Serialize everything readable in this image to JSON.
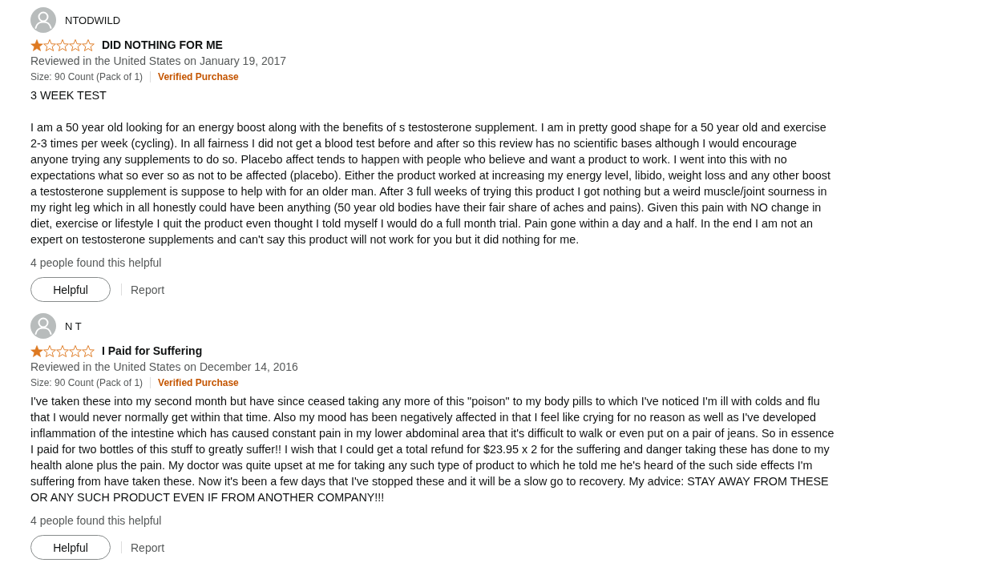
{
  "reviews": [
    {
      "author": "NTODWILD",
      "stars": 1,
      "title": "DID NOTHING FOR ME",
      "date": "Reviewed in the United States on January 19, 2017",
      "size": "Size: 90 Count (Pack of 1)",
      "verified": "Verified Purchase",
      "paragraphs": [
        "3 WEEK TEST",
        "I am a 50 year old looking for an energy boost along with the benefits of s testosterone supplement. I am in pretty good shape for a 50 year old and exercise 2-3 times per week (cycling). In all fairness I did not get a blood test before and after so this review has no scientific bases although I would encourage anyone trying any supplements to do so. Placebo affect tends to happen with people who believe and want a product to work. I went into this with no expectations what so ever so as not to be affected (placebo). Either the product worked at increasing my energy level, libido, weight loss and any other boost a testosterone supplement is suppose to help with for an older man. After 3 full weeks of trying this product I got nothing but a weird muscle/joint sourness in my right leg which in all honestly could have been anything (50 year old bodies have their fair share of aches and pains). Given this pain with NO change in diet, exercise or lifestyle I quit the product even thought I told myself I would do a full month trial. Pain gone within a day and a half. In the end I am not an expert on testosterone supplements and can't say this product will not work for you but it did nothing for me."
      ],
      "helpful_count": "4 people found this helpful",
      "helpful_button": "Helpful",
      "report_link": "Report"
    },
    {
      "author": "N T",
      "stars": 1,
      "title": "I Paid for Suffering",
      "date": "Reviewed in the United States on December 14, 2016",
      "size": "Size: 90 Count (Pack of 1)",
      "verified": "Verified Purchase",
      "paragraphs": [
        "I've taken these into my second month but have since ceased taking any more of this \"poison\" to my body pills to which I've noticed I'm ill with colds and flu that I would never normally get within that time. Also my mood has been negatively affected in that I feel like crying for no reason as well as I've developed inflammation of the intestine which has caused constant pain in my lower abdominal area that it's difficult to walk or even put on a pair of jeans. So in essence I paid for two bottles of this stuff to greatly suffer!! I wish that I could get a total refund for $23.95 x 2 for the suffering and danger taking these has done to my health alone plus the pain. My doctor was quite upset at me for taking any such type of product to which he told me he's heard of the such side effects I'm suffering from have taken these. Now it's been a few days that I've stopped these and it will be a slow go to recovery. My advice: STAY AWAY FROM THESE OR ANY SUCH PRODUCT EVEN IF FROM ANOTHER COMPANY!!!"
      ],
      "helpful_count": "4 people found this helpful",
      "helpful_button": "Helpful",
      "report_link": "Report"
    }
  ]
}
